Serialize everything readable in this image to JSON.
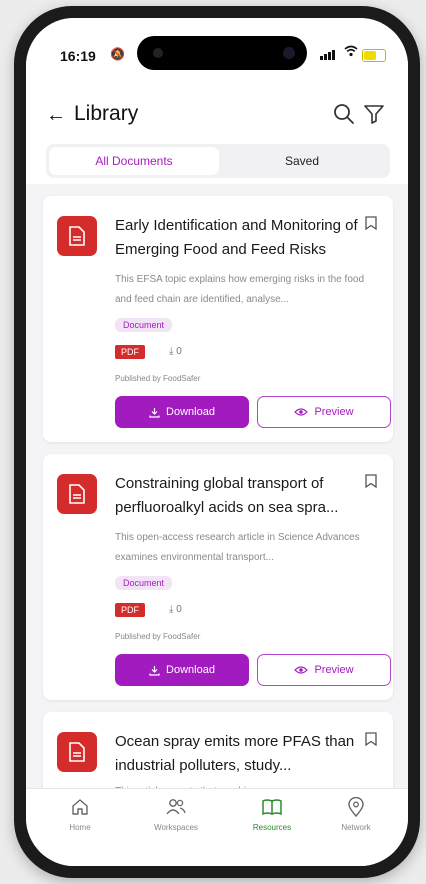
{
  "status": {
    "time": "16:19",
    "mute_symbol": "🔕",
    "battery_percent": 60
  },
  "header": {
    "title": "Library",
    "back_icon": "arrow-left-icon",
    "search_icon": "search-icon",
    "filter_icon": "filter-icon"
  },
  "tabs": [
    {
      "label": "All Documents",
      "active": true
    },
    {
      "label": "Saved",
      "active": false
    }
  ],
  "documents": [
    {
      "title": "Early Identification and Monitoring of Emerging Food and Feed Risks",
      "description": "This EFSA topic explains how emerging risks in the food and feed chain are identified, analyse...",
      "category": "Document",
      "file_type": "PDF",
      "downloads": "0",
      "publisher": "Published by FoodSafer",
      "download_label": "Download",
      "preview_label": "Preview"
    },
    {
      "title": "Constraining global transport of perfluoroalkyl acids on sea spra...",
      "description": "This open-access research article in Science Advances examines environmental transport...",
      "category": "Document",
      "file_type": "PDF",
      "downloads": "0",
      "publisher": "Published by FoodSafer",
      "download_label": "Download",
      "preview_label": "Preview"
    },
    {
      "title": "Ocean spray emits more PFAS than industrial polluters, study...",
      "description": "This article reports that crashing ocean waves..."
    }
  ],
  "tabbar": [
    {
      "label": "Home",
      "icon": "home-icon",
      "active": false
    },
    {
      "label": "Workspaces",
      "icon": "users-icon",
      "active": false
    },
    {
      "label": "Resources",
      "icon": "book-icon",
      "active": true
    },
    {
      "label": "Network",
      "icon": "location-pin-icon",
      "active": false
    }
  ],
  "colors": {
    "accent": "#a21bbf",
    "pdf_red": "#d42b2b",
    "active_tab": "#2c8a2c"
  }
}
